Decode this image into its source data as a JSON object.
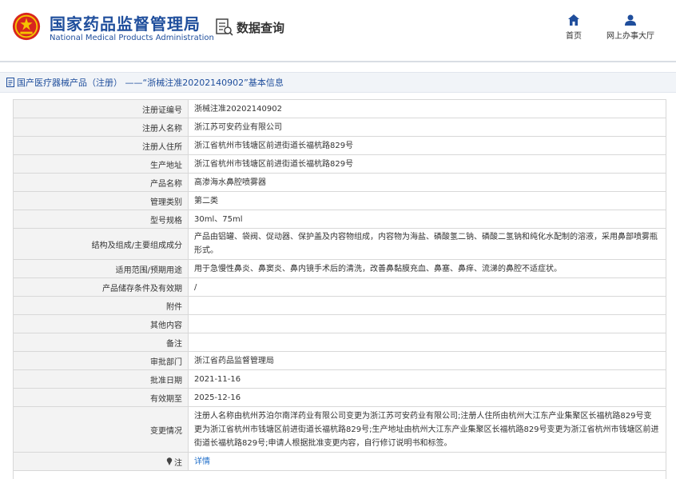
{
  "header": {
    "logo_cn": "国家药品监督管理局",
    "logo_en": "National Medical Products Administration",
    "data_query": "数据查询",
    "nav": [
      {
        "label": "首页",
        "icon": "home-icon"
      },
      {
        "label": "网上办事大厅",
        "icon": "user-icon"
      }
    ]
  },
  "breadcrumb": "国产医疗器械产品（注册） ——“浙械注准20202140902”基本信息",
  "rows": [
    {
      "label": "注册证编号",
      "value": "浙械注准20202140902"
    },
    {
      "label": "注册人名称",
      "value": "浙江苏可安药业有限公司"
    },
    {
      "label": "注册人住所",
      "value": "浙江省杭州市钱塘区前进街道长福杭路829号"
    },
    {
      "label": "生产地址",
      "value": "浙江省杭州市钱塘区前进街道长福杭路829号"
    },
    {
      "label": "产品名称",
      "value": "高渗海水鼻腔喷雾器"
    },
    {
      "label": "管理类别",
      "value": "第二类"
    },
    {
      "label": "型号规格",
      "value": "30ml、75ml"
    },
    {
      "label": "结构及组成/主要组成成分",
      "value": "产品由铝罐、袋阀、促动器、保护盖及内容物组成，内容物为海盐、磷酸氢二钠、磷酸二氢钠和纯化水配制的溶液，采用鼻部喷雾瓶形式。"
    },
    {
      "label": "适用范围/预期用途",
      "value": "用于急慢性鼻炎、鼻窦炎、鼻内镜手术后的清洗，改善鼻黏膜充血、鼻塞、鼻痒、流涕的鼻腔不适症状。"
    },
    {
      "label": "产品储存条件及有效期",
      "value": "/"
    },
    {
      "label": "附件",
      "value": ""
    },
    {
      "label": "其他内容",
      "value": ""
    },
    {
      "label": "备注",
      "value": ""
    },
    {
      "label": "审批部门",
      "value": "浙江省药品监督管理局"
    },
    {
      "label": "批准日期",
      "value": "2021-11-16"
    },
    {
      "label": "有效期至",
      "value": "2025-12-16"
    },
    {
      "label": "变更情况",
      "value": "注册人名称由杭州苏泊尔南洋药业有限公司变更为浙江苏可安药业有限公司;注册人住所由杭州大江东产业集聚区长福杭路829号变更为浙江省杭州市钱塘区前进街道长福杭路829号;生产地址由杭州大江东产业集聚区长福杭路829号变更为浙江省杭州市钱塘区前进街道长福杭路829号;申请人根据批准变更内容，自行修订说明书和标签。"
    },
    {
      "label": "注",
      "value": "详情",
      "icon": "pin-icon"
    }
  ]
}
